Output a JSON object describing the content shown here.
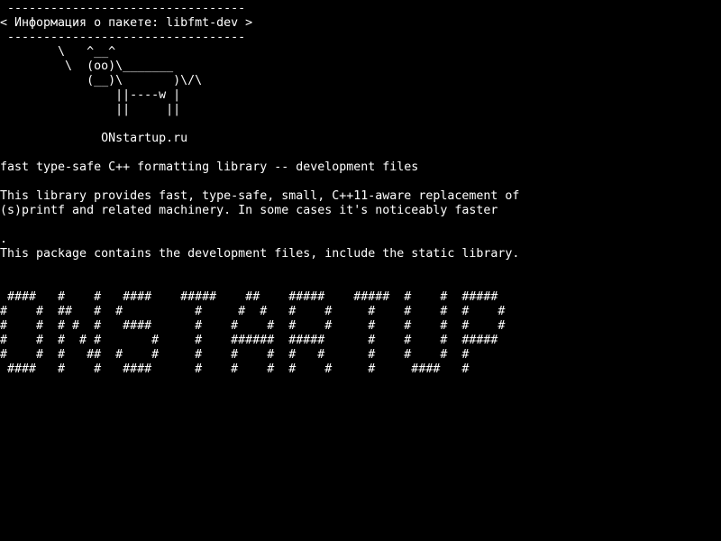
{
  "screen": {
    "background": "#000000",
    "foreground": "#ffffff",
    "lines": [
      " ---------------------------------",
      "< Информация о пакете: libfmt-dev >",
      " ---------------------------------",
      "        \\   ^__^",
      "         \\  (oo)\\_______",
      "            (__)\\       )\\/\\",
      "                ||----w |",
      "                ||     ||",
      "",
      "              ONstartup.ru",
      "",
      "fast type-safe C++ formatting library -- development files",
      "",
      "This library provides fast, type-safe, small, C++11-aware replacement of",
      "(s)printf and related machinery. In some cases it's noticeably faster",
      "",
      ".",
      "This package contains the development files, include the static library.",
      "",
      "",
      " ####   #    #   ####    #####    ##    #####    #####  #    #  #####",
      "#    #  ##   #  #          #     #  #   #    #     #    #    #  #    #",
      "#    #  # #  #   ####      #    #    #  #    #     #    #    #  #    #",
      "#    #  #  # #       #     #    ######  #####      #    #    #  #####",
      "#    #  #   ##  #    #     #    #    #  #   #      #    #    #  #",
      " ####   #    #   ####      #    #    #  #    #     #     ####   #"
    ]
  }
}
